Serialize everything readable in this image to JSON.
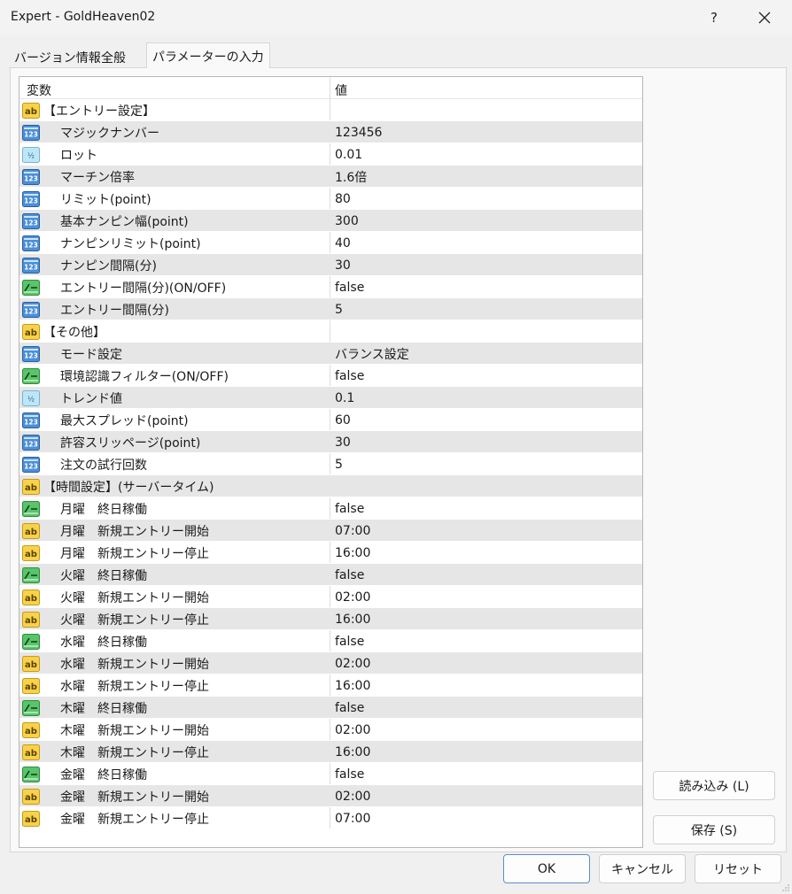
{
  "window": {
    "title": "Expert - GoldHeaven02",
    "help_label": "?",
    "close_label": "✕"
  },
  "tabs": [
    {
      "label": "バージョン情報"
    },
    {
      "label": "全般"
    },
    {
      "label": "パラメーターの入力"
    }
  ],
  "grid": {
    "col_variable": "変数",
    "col_value": "値",
    "rows": [
      {
        "type": "ab",
        "name": "【エントリー設定】",
        "value": "",
        "section": true
      },
      {
        "type": "int",
        "name": "マジックナンバー",
        "value": "123456"
      },
      {
        "type": "dbl",
        "name": "ロット",
        "value": "0.01"
      },
      {
        "type": "int",
        "name": "マーチン倍率",
        "value": "1.6倍"
      },
      {
        "type": "int",
        "name": "リミット(point)",
        "value": "80"
      },
      {
        "type": "int",
        "name": "基本ナンピン幅(point)",
        "value": "300"
      },
      {
        "type": "int",
        "name": "ナンピンリミット(point)",
        "value": "40"
      },
      {
        "type": "int",
        "name": "ナンピン間隔(分)",
        "value": "30"
      },
      {
        "type": "bool",
        "name": "エントリー間隔(分)(ON/OFF)",
        "value": "false"
      },
      {
        "type": "int",
        "name": "エントリー間隔(分)",
        "value": "5"
      },
      {
        "type": "ab",
        "name": "【その他】",
        "value": "",
        "section": true
      },
      {
        "type": "int",
        "name": "モード設定",
        "value": "バランス設定"
      },
      {
        "type": "bool",
        "name": "環境認識フィルター(ON/OFF)",
        "value": "false"
      },
      {
        "type": "dbl",
        "name": "トレンド値",
        "value": "0.1"
      },
      {
        "type": "int",
        "name": "最大スプレッド(point)",
        "value": "60"
      },
      {
        "type": "int",
        "name": "許容スリッページ(point)",
        "value": "30"
      },
      {
        "type": "int",
        "name": "注文の試行回数",
        "value": "5"
      },
      {
        "type": "ab",
        "name": "【時間設定】(サーバータイム)",
        "value": "",
        "section": true
      },
      {
        "type": "bool",
        "name": "月曜　終日稼働",
        "value": "false"
      },
      {
        "type": "ab",
        "name": "月曜　新規エントリー開始",
        "value": "07:00"
      },
      {
        "type": "ab",
        "name": "月曜　新規エントリー停止",
        "value": "16:00"
      },
      {
        "type": "bool",
        "name": "火曜　終日稼働",
        "value": "false"
      },
      {
        "type": "ab",
        "name": "火曜　新規エントリー開始",
        "value": "02:00"
      },
      {
        "type": "ab",
        "name": "火曜　新規エントリー停止",
        "value": "16:00"
      },
      {
        "type": "bool",
        "name": "水曜　終日稼働",
        "value": "false"
      },
      {
        "type": "ab",
        "name": "水曜　新規エントリー開始",
        "value": "02:00"
      },
      {
        "type": "ab",
        "name": "水曜　新規エントリー停止",
        "value": "16:00"
      },
      {
        "type": "bool",
        "name": "木曜　終日稼働",
        "value": "false"
      },
      {
        "type": "ab",
        "name": "木曜　新規エントリー開始",
        "value": "02:00"
      },
      {
        "type": "ab",
        "name": "木曜　新規エントリー停止",
        "value": "16:00"
      },
      {
        "type": "bool",
        "name": "金曜　終日稼働",
        "value": "false"
      },
      {
        "type": "ab",
        "name": "金曜　新規エントリー開始",
        "value": "02:00"
      },
      {
        "type": "ab",
        "name": "金曜　新規エントリー停止",
        "value": "07:00"
      }
    ]
  },
  "icons": {
    "ab": "string-type-icon",
    "int": "integer-type-icon",
    "dbl": "double-type-icon",
    "bool": "bool-type-icon"
  },
  "buttons": {
    "load": "読み込み (L)",
    "save": "保存 (S)",
    "ok": "OK",
    "cancel": "キャンセル",
    "reset": "リセット"
  },
  "colors": {
    "accent_border": "#5a8fc6",
    "row_alt": "#e6e6e6"
  }
}
